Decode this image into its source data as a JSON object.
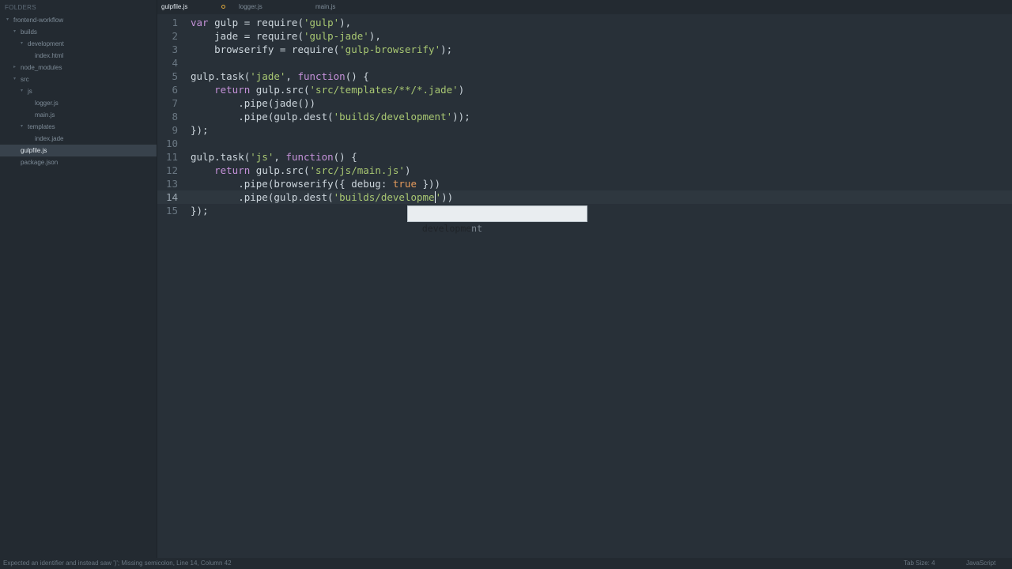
{
  "sidebar": {
    "header": "FOLDERS",
    "items": [
      {
        "label": "frontend-workflow",
        "arrow": "▾",
        "selected": false
      },
      {
        "label": "builds",
        "arrow": "▾",
        "selected": false
      },
      {
        "label": "development",
        "arrow": "▾",
        "selected": false
      },
      {
        "label": "index.html",
        "arrow": "",
        "selected": false
      },
      {
        "label": "node_modules",
        "arrow": "▸",
        "selected": false
      },
      {
        "label": "src",
        "arrow": "▾",
        "selected": false
      },
      {
        "label": "js",
        "arrow": "▾",
        "selected": false
      },
      {
        "label": "logger.js",
        "arrow": "",
        "selected": false
      },
      {
        "label": "main.js",
        "arrow": "",
        "selected": false
      },
      {
        "label": "templates",
        "arrow": "▾",
        "selected": false
      },
      {
        "label": "index.jade",
        "arrow": "",
        "selected": false
      },
      {
        "label": "gulpfile.js",
        "arrow": "",
        "selected": true
      },
      {
        "label": "package.json",
        "arrow": "",
        "selected": false
      }
    ]
  },
  "tabs": [
    {
      "label": "gulpfile.js",
      "active": true,
      "dirty": true
    },
    {
      "label": "logger.js",
      "active": false,
      "dirty": false
    },
    {
      "label": "main.js",
      "active": false,
      "dirty": false
    }
  ],
  "editor": {
    "current_line": 14,
    "lines": [
      {
        "n": "1",
        "tokens": [
          {
            "t": "var",
            "k": "kw"
          },
          {
            "t": " gulp = require(",
            "k": "txt"
          },
          {
            "t": "'gulp'",
            "k": "str"
          },
          {
            "t": "),",
            "k": "txt"
          }
        ]
      },
      {
        "n": "2",
        "tokens": [
          {
            "t": "    jade = require(",
            "k": "txt"
          },
          {
            "t": "'gulp-jade'",
            "k": "str"
          },
          {
            "t": "),",
            "k": "txt"
          }
        ]
      },
      {
        "n": "3",
        "tokens": [
          {
            "t": "    browserify = require(",
            "k": "txt"
          },
          {
            "t": "'gulp-browserify'",
            "k": "str"
          },
          {
            "t": ");",
            "k": "txt"
          }
        ]
      },
      {
        "n": "4",
        "tokens": []
      },
      {
        "n": "5",
        "tokens": [
          {
            "t": "gulp.task(",
            "k": "txt"
          },
          {
            "t": "'jade'",
            "k": "str"
          },
          {
            "t": ", ",
            "k": "txt"
          },
          {
            "t": "function",
            "k": "kw"
          },
          {
            "t": "() {",
            "k": "txt"
          }
        ]
      },
      {
        "n": "6",
        "tokens": [
          {
            "t": "    ",
            "k": "txt"
          },
          {
            "t": "return",
            "k": "kw"
          },
          {
            "t": " gulp.src(",
            "k": "txt"
          },
          {
            "t": "'src/templates/**/*.jade'",
            "k": "str"
          },
          {
            "t": ")",
            "k": "txt"
          }
        ]
      },
      {
        "n": "7",
        "tokens": [
          {
            "t": "        .pipe(jade())",
            "k": "txt"
          }
        ]
      },
      {
        "n": "8",
        "tokens": [
          {
            "t": "        .pipe(gulp.dest(",
            "k": "txt"
          },
          {
            "t": "'builds/development'",
            "k": "str"
          },
          {
            "t": "));",
            "k": "txt"
          }
        ]
      },
      {
        "n": "9",
        "tokens": [
          {
            "t": "});",
            "k": "txt"
          }
        ]
      },
      {
        "n": "10",
        "tokens": []
      },
      {
        "n": "11",
        "tokens": [
          {
            "t": "gulp.task(",
            "k": "txt"
          },
          {
            "t": "'js'",
            "k": "str"
          },
          {
            "t": ", ",
            "k": "txt"
          },
          {
            "t": "function",
            "k": "kw"
          },
          {
            "t": "() {",
            "k": "txt"
          }
        ]
      },
      {
        "n": "12",
        "tokens": [
          {
            "t": "    ",
            "k": "txt"
          },
          {
            "t": "return",
            "k": "kw"
          },
          {
            "t": " gulp.src(",
            "k": "txt"
          },
          {
            "t": "'src/js/main.js'",
            "k": "str"
          },
          {
            "t": ")",
            "k": "txt"
          }
        ]
      },
      {
        "n": "13",
        "tokens": [
          {
            "t": "        .pipe(browserify({ debug: ",
            "k": "txt"
          },
          {
            "t": "true",
            "k": "bool"
          },
          {
            "t": " }))",
            "k": "txt"
          }
        ]
      },
      {
        "n": "14",
        "tokens": [
          {
            "t": "        .pipe(gulp.dest(",
            "k": "txt"
          },
          {
            "t": "'builds/developme",
            "k": "str",
            "cursor": true
          },
          {
            "t": "'",
            "k": "str"
          },
          {
            "t": "))",
            "k": "txt"
          }
        ]
      },
      {
        "n": "15",
        "tokens": [
          {
            "t": "});",
            "k": "txt"
          }
        ]
      }
    ]
  },
  "autocomplete": {
    "match": "developme",
    "rest": "nt"
  },
  "status": {
    "message": "Expected an identifier and instead saw ')'; Missing semicolon, Line 14, Column 42",
    "tab_size": "Tab Size: 4",
    "syntax": "JavaScript"
  },
  "colors": {
    "background": "#283038",
    "sidebar": "#232a31",
    "keyword": "#c491d8",
    "string": "#a8c772",
    "boolean": "#e49a5c",
    "dirty_indicator": "#d9a53c"
  }
}
